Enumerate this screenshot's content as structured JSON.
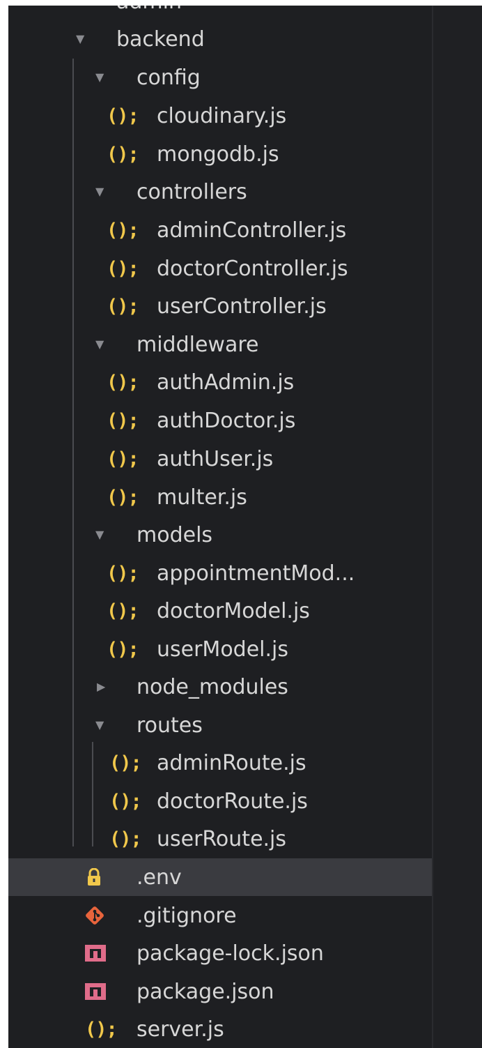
{
  "explorer": {
    "top_partial_label": "admin",
    "rows": [
      {
        "type": "folder",
        "name": "backend",
        "expanded": true
      },
      {
        "type": "folder",
        "name": "config",
        "expanded": true
      },
      {
        "type": "file",
        "name": "cloudinary.js",
        "icon": "js-icon"
      },
      {
        "type": "file",
        "name": "mongodb.js",
        "icon": "js-icon"
      },
      {
        "type": "folder",
        "name": "controllers",
        "expanded": true
      },
      {
        "type": "file",
        "name": "adminController.js",
        "icon": "js-icon"
      },
      {
        "type": "file",
        "name": "doctorController.js",
        "icon": "js-icon"
      },
      {
        "type": "file",
        "name": "userController.js",
        "icon": "js-icon"
      },
      {
        "type": "folder",
        "name": "middleware",
        "expanded": true
      },
      {
        "type": "file",
        "name": "authAdmin.js",
        "icon": "js-icon"
      },
      {
        "type": "file",
        "name": "authDoctor.js",
        "icon": "js-icon"
      },
      {
        "type": "file",
        "name": "authUser.js",
        "icon": "js-icon"
      },
      {
        "type": "file",
        "name": "multer.js",
        "icon": "js-icon"
      },
      {
        "type": "folder",
        "name": "models",
        "expanded": true
      },
      {
        "type": "file",
        "name": "appointmentMod...",
        "icon": "js-icon"
      },
      {
        "type": "file",
        "name": "doctorModel.js",
        "icon": "js-icon"
      },
      {
        "type": "file",
        "name": "userModel.js",
        "icon": "js-icon"
      },
      {
        "type": "folder",
        "name": "node_modules",
        "expanded": false
      },
      {
        "type": "folder",
        "name": "routes",
        "expanded": true
      },
      {
        "type": "file",
        "name": "adminRoute.js",
        "icon": "js-icon"
      },
      {
        "type": "file",
        "name": "doctorRoute.js",
        "icon": "js-icon"
      },
      {
        "type": "file",
        "name": "userRoute.js",
        "icon": "js-icon"
      },
      {
        "type": "file",
        "name": ".env",
        "icon": "lock-icon",
        "selected": true
      },
      {
        "type": "file",
        "name": ".gitignore",
        "icon": "git-icon"
      },
      {
        "type": "file",
        "name": "package-lock.json",
        "icon": "npm-icon"
      },
      {
        "type": "file",
        "name": "package.json",
        "icon": "npm-icon"
      },
      {
        "type": "file",
        "name": "server.js",
        "icon": "js-icon"
      }
    ],
    "js_icon_glyph": "();",
    "collapse_glyph": "▼",
    "expand_glyph": "▶"
  },
  "colors": {
    "background": "#1e1f22",
    "selected_row": "#3a3b40",
    "text": "#d7d7d7",
    "js_icon": "#f1c84b",
    "lock_icon": "#f1c84b",
    "git_icon": "#e8643c",
    "npm_icon": "#e06c8a"
  }
}
